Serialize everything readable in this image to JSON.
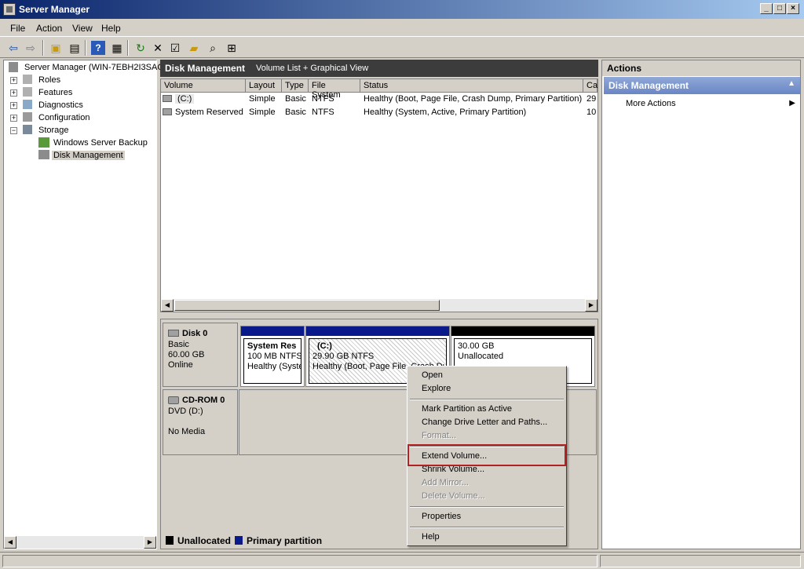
{
  "window": {
    "title": "Server Manager"
  },
  "menubar": {
    "items": [
      "File",
      "Action",
      "View",
      "Help"
    ]
  },
  "toolbar": {
    "icons": [
      "back-icon",
      "forward-icon",
      "up-icon",
      "show-hide-tree-icon",
      "help-icon",
      "properties-pane-icon",
      "refresh-icon",
      "delete-icon",
      "settings-icon",
      "open-folder-icon",
      "search-icon",
      "disk-icon"
    ]
  },
  "tree": {
    "root": "Server Manager (WIN-7EBH2I3SAC",
    "items": [
      {
        "label": "Roles",
        "expander": "+"
      },
      {
        "label": "Features",
        "expander": "+"
      },
      {
        "label": "Diagnostics",
        "expander": "+"
      },
      {
        "label": "Configuration",
        "expander": "+"
      },
      {
        "label": "Storage",
        "expander": "−"
      },
      {
        "label": "Windows Server Backup"
      },
      {
        "label": "Disk Management"
      }
    ]
  },
  "center": {
    "header_title": "Disk Management",
    "header_views": "Volume List + Graphical View",
    "columns": [
      "Volume",
      "Layout",
      "Type",
      "File System",
      "Status",
      "Ca"
    ],
    "rows": [
      {
        "volume": "(C:)",
        "layout": "Simple",
        "type": "Basic",
        "fs": "NTFS",
        "status": "Healthy (Boot, Page File, Crash Dump, Primary Partition)",
        "cap": "29"
      },
      {
        "volume": "System Reserved",
        "layout": "Simple",
        "type": "Basic",
        "fs": "NTFS",
        "status": "Healthy (System, Active, Primary Partition)",
        "cap": "10"
      }
    ]
  },
  "disks": {
    "disk0": {
      "name": "Disk 0",
      "type": "Basic",
      "size": "60.00 GB",
      "state": "Online"
    },
    "partitions": [
      {
        "title": "System Res",
        "line1": "100 MB NTFS",
        "line2": "Healthy (Syste",
        "color": "#0a1a8a"
      },
      {
        "title": "(C:)",
        "line1": "29.90 GB NTFS",
        "line2": "Healthy (Boot, Page File, Crash Dur",
        "color": "#0a1a8a"
      },
      {
        "title": "",
        "line1": "30.00 GB",
        "line2": "Unallocated",
        "color": "#000000"
      }
    ],
    "cdrom": {
      "name": "CD-ROM 0",
      "type": "DVD (D:)",
      "media": "No Media"
    }
  },
  "legend": {
    "unallocated": "Unallocated",
    "primary": "Primary partition",
    "unallocated_color": "#000000",
    "primary_color": "#0a1a8a"
  },
  "actions": {
    "header": "Actions",
    "section": "Disk Management",
    "items": [
      "More Actions"
    ]
  },
  "context_menu": {
    "items": [
      {
        "label": "Open",
        "enabled": true
      },
      {
        "label": "Explore",
        "enabled": true
      },
      {
        "label": "Mark Partition as Active",
        "enabled": true
      },
      {
        "label": "Change Drive Letter and Paths...",
        "enabled": true
      },
      {
        "label": "Format...",
        "enabled": false
      },
      {
        "label": "Extend Volume...",
        "enabled": true
      },
      {
        "label": "Shrink Volume...",
        "enabled": true
      },
      {
        "label": "Add Mirror...",
        "enabled": false
      },
      {
        "label": "Delete Volume...",
        "enabled": false
      },
      {
        "label": "Properties",
        "enabled": true
      },
      {
        "label": "Help",
        "enabled": true
      }
    ],
    "highlight_color": "#b22222"
  }
}
